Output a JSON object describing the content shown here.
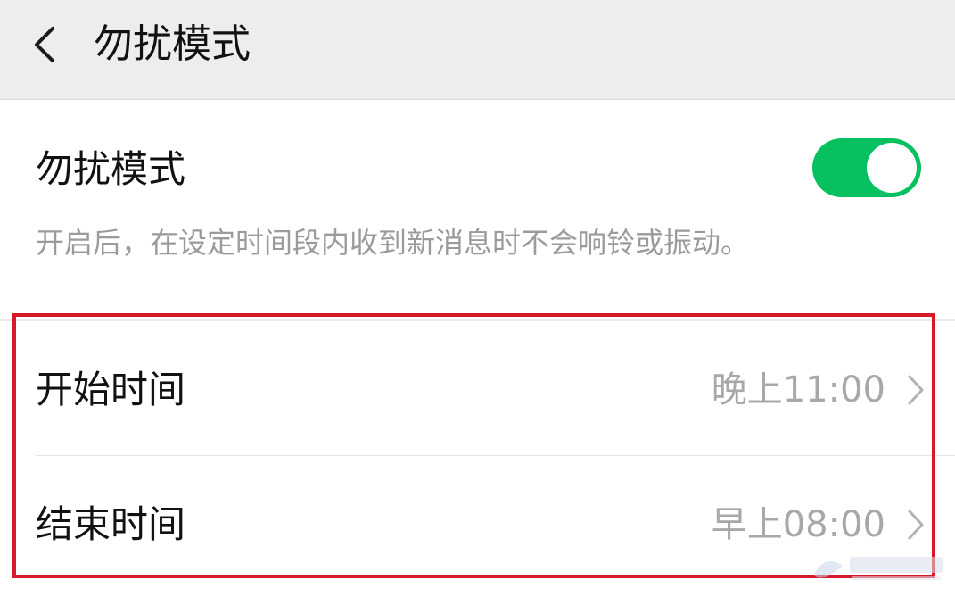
{
  "header": {
    "title": "勿扰模式",
    "back_icon": "chevron-left-icon"
  },
  "dnd": {
    "label": "勿扰模式",
    "enabled": true,
    "toggle_color": "#07c160",
    "description": "开启后，在设定时间段内收到新消息时不会响铃或振动。"
  },
  "schedule": {
    "start": {
      "label": "开始时间",
      "value": "晚上11:00",
      "chevron_icon": "chevron-right-icon"
    },
    "end": {
      "label": "结束时间",
      "value": "早上08:00",
      "chevron_icon": "chevron-right-icon"
    }
  },
  "annotation": {
    "highlight_color": "#d7192a"
  }
}
